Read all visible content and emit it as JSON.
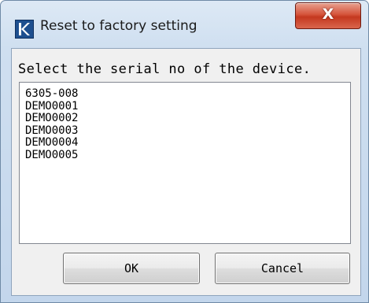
{
  "window": {
    "title": "Reset to factory setting",
    "close_glyph": "X",
    "icon": "kyoritsu-k-icon"
  },
  "dialog": {
    "prompt": "Select the serial no of the device.",
    "serials": [
      "6305-008",
      "DEMO0001",
      "DEMO0002",
      "DEMO0003",
      "DEMO0004",
      "DEMO0005"
    ]
  },
  "buttons": {
    "ok_label": "OK",
    "cancel_label": "Cancel"
  }
}
